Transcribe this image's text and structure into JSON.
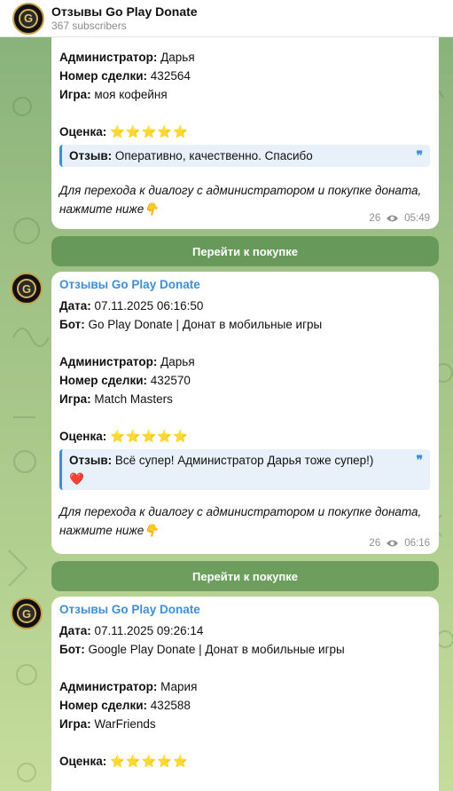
{
  "header": {
    "title": "Отзывы Go Play Donate",
    "subscribers": "367 subscribers"
  },
  "labels": {
    "date": "Дата:",
    "bot": "Бот:",
    "admin": "Администратор:",
    "deal": "Номер сделки:",
    "game": "Игра:",
    "rating": "Оценка:",
    "review": "Отзыв:"
  },
  "rating_stars": "⭐⭐⭐⭐⭐",
  "quote_mark": "❞",
  "footer_note": [
    "Для перехода к диалогу с администратором и покупке доната,",
    "нажмите ниже👇"
  ],
  "buy_button_label": "Перейти к покупке",
  "messages": [
    {
      "admin": "Дарья",
      "deal": "432564",
      "game": "моя кофейня",
      "review": "Оперативно, качественно. Спасибо",
      "views": "26",
      "time": "05:49"
    },
    {
      "channel": "Отзывы Go Play Donate",
      "date": "07.11.2025 06:16:50",
      "bot": "Go Play Donate | Донат в мобильные игры",
      "admin": "Дарья",
      "deal": "432570",
      "game": "Match Masters",
      "review": "Всё супер! Администратор Дарья тоже супер!)",
      "review_line2": "❤️",
      "views": "26",
      "time": "06:16"
    },
    {
      "channel": "Отзывы Go Play Donate",
      "date": "07.11.2025 09:26:14",
      "bot": "Google Play Donate | Донат в мобильные игры",
      "admin": "Мария",
      "deal": "432588",
      "game": "WarFriends"
    }
  ]
}
